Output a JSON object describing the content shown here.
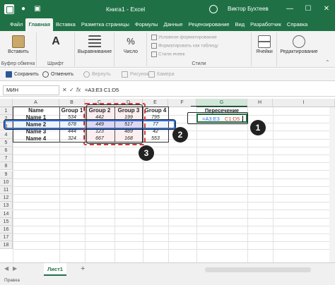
{
  "titlebar": {
    "title": "Книга1 - Excel",
    "user": "Виктор Бухтеев",
    "minimize": "—",
    "maximize": "☐",
    "close": "✕"
  },
  "menu": {
    "tabs": [
      "Файл",
      "Главная",
      "Вставка",
      "Разметка страницы",
      "Формулы",
      "Данные",
      "Рецензирование",
      "Вид",
      "Разработчик",
      "Справка"
    ],
    "active": "Главная"
  },
  "ribbon": {
    "paste": "Вставить",
    "clipboard": "Буфер обмена",
    "font": "Шрифт",
    "align": "Выравнивание",
    "number": "Число",
    "cond_format": "Условное форматирование",
    "format_table": "Форматировать как таблицу",
    "cell_styles": "Стили ячеек",
    "styles": "Стили",
    "cells": "Ячейки",
    "editing": "Редактирование"
  },
  "quick_access": {
    "save": "Сохранить",
    "undo": "Отменить",
    "redo": "Вернуть",
    "image": "Рисунок",
    "camera": "Камера"
  },
  "formula_bar": {
    "name_box": "МИН",
    "fx": "fx",
    "formula": "=A3:E3 C1:D5"
  },
  "grid": {
    "columns": [
      "A",
      "B",
      "C",
      "D",
      "E",
      "F",
      "G",
      "H",
      "I"
    ],
    "rows": [
      "1",
      "2",
      "3",
      "4",
      "5",
      "6",
      "7",
      "8",
      "9",
      "10",
      "11",
      "12",
      "13",
      "14",
      "15",
      "16",
      "17",
      "18"
    ],
    "headers": [
      "Name",
      "Group 1",
      "Group 2",
      "Group 3",
      "Group 4"
    ],
    "data": [
      [
        "Name 1",
        "534",
        "442",
        "199",
        "795"
      ],
      [
        "Name 2",
        "678",
        "449",
        "517",
        "77"
      ],
      [
        "Name 3",
        "444",
        "123",
        "489",
        "42"
      ],
      [
        "Name 4",
        "324",
        "667",
        "168",
        "553"
      ]
    ],
    "g1_label": "Пересечение",
    "g2_formula_a": "=A3:E3",
    "g2_formula_b": "C1:D5"
  },
  "sheet": {
    "tab": "Лист1",
    "add": "+"
  },
  "status": {
    "mode": "Правка"
  },
  "badges": [
    "1",
    "2",
    "3"
  ],
  "colors": {
    "excel_green": "#1f7145",
    "range_blue": "#2d6fd8",
    "range_red": "#d43c3c",
    "intersect_fill": "#dfd7f0"
  }
}
